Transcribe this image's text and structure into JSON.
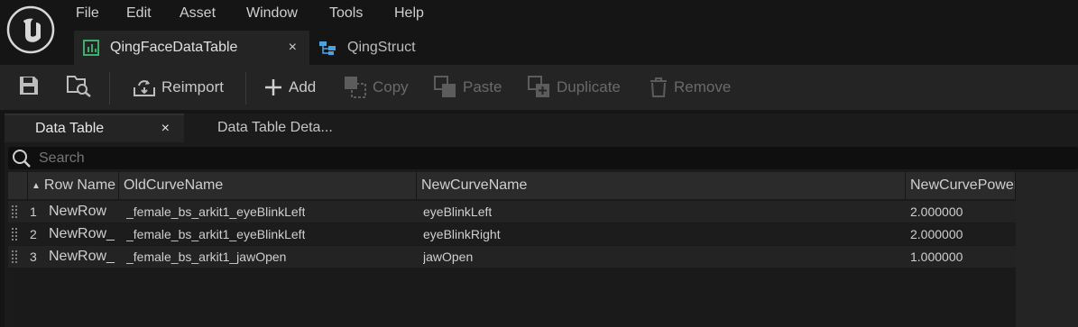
{
  "menu": {
    "file": "File",
    "edit": "Edit",
    "asset": "Asset",
    "window": "Window",
    "tools": "Tools",
    "help": "Help"
  },
  "tabs": [
    {
      "label": "QingFaceDataTable",
      "close": "×"
    },
    {
      "label": "QingStruct"
    }
  ],
  "toolbar": {
    "reimport": "Reimport",
    "add": "Add",
    "copy": "Copy",
    "paste": "Paste",
    "duplicate": "Duplicate",
    "remove": "Remove"
  },
  "inner_tabs": [
    {
      "label": "Data Table",
      "close": "×"
    },
    {
      "label": "Data Table Deta..."
    }
  ],
  "search": {
    "placeholder": "Search"
  },
  "table": {
    "columns": [
      "Row Name",
      "OldCurveName",
      "NewCurveName",
      "NewCurvePower"
    ],
    "rows": [
      {
        "index": "1",
        "row_name": "NewRow",
        "old": "_female_bs_arkit1_eyeBlinkLeft",
        "new": "eyeBlinkLeft",
        "power": "2.000000"
      },
      {
        "index": "2",
        "row_name": "NewRow_",
        "old": "_female_bs_arkit1_eyeBlinkLeft",
        "new": "eyeBlinkRight",
        "power": "2.000000"
      },
      {
        "index": "3",
        "row_name": "NewRow_",
        "old": "_female_bs_arkit1_jawOpen",
        "new": "jawOpen",
        "power": "1.000000"
      }
    ]
  },
  "colors": {
    "accent_green": "#38b26a",
    "accent_blue": "#4aa3df",
    "bg": "#151515",
    "toolbar": "#242424"
  }
}
